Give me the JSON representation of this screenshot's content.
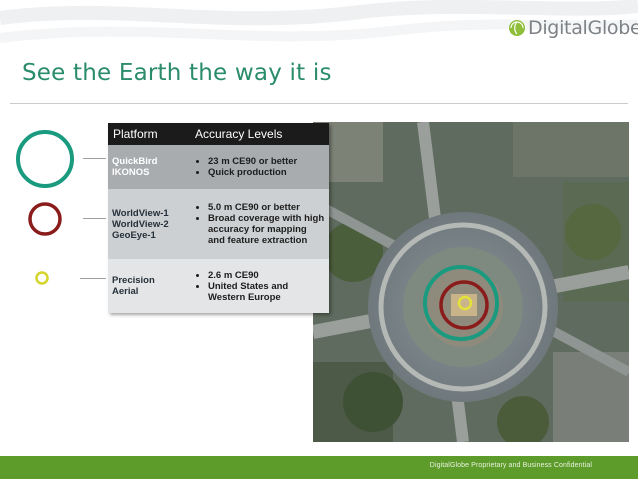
{
  "logo": {
    "text": "DigitalGlobe"
  },
  "title": "See the Earth the way it is",
  "table": {
    "headers": [
      "Platform",
      "Accuracy Levels"
    ],
    "rows": [
      {
        "platform": [
          "QuickBird",
          "IKONOS"
        ],
        "accuracy": [
          "23 m CE90 or better",
          "Quick production"
        ],
        "legend": "large teal circle"
      },
      {
        "platform": [
          "WorldView-1",
          "WorldView-2",
          "GeoEye-1"
        ],
        "accuracy": [
          "5.0 m CE90 or better",
          "Broad coverage with high accuracy for mapping and feature extraction"
        ],
        "legend": "medium dark red circle"
      },
      {
        "platform": [
          "Precision",
          "Aerial"
        ],
        "accuracy": [
          "2.6 m CE90",
          "United States and Western Europe"
        ],
        "legend": "small yellow-green circle"
      }
    ]
  },
  "colors": {
    "title": "#2a8c6b",
    "teal_circle": "#1a9a7e",
    "red_circle": "#8a1c1c",
    "yellow_circle": "#d4d42a",
    "footer_bar": "#5d9b2a"
  },
  "footer": {
    "text": "DigitalGlobe Proprietary and Business Confidential"
  }
}
